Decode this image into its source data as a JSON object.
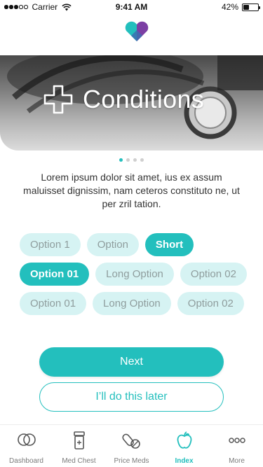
{
  "status_bar": {
    "carrier": "Carrier",
    "time": "9:41 AM",
    "battery_percent": "42%",
    "battery_level": 0.42
  },
  "colors": {
    "accent": "#23bfbd",
    "chip_bg": "#d6f3f3",
    "logo_left": "#23bfbd",
    "logo_right": "#7c3fa4"
  },
  "hero": {
    "title": "Conditions",
    "icon": "plus-cross-icon"
  },
  "pager": {
    "count": 4,
    "active_index": 0
  },
  "description": "Lorem ipsum dolor sit amet, ius ex assum maluisset dignissim, nam ceteros constituto ne, ut per zril tation.",
  "options": {
    "rows": [
      [
        {
          "label": "Option 1",
          "selected": false
        },
        {
          "label": "Option",
          "selected": false
        },
        {
          "label": "Short",
          "selected": true
        }
      ],
      [
        {
          "label": "Option 01",
          "selected": true
        },
        {
          "label": "Long Option",
          "selected": false
        },
        {
          "label": "Option 02",
          "selected": false
        }
      ],
      [
        {
          "label": "Option 01",
          "selected": false
        },
        {
          "label": "Long Option",
          "selected": false
        },
        {
          "label": "Option 02",
          "selected": false
        }
      ]
    ]
  },
  "buttons": {
    "next": "Next",
    "later": "I’ll do this later"
  },
  "tab_bar": {
    "items": [
      {
        "label": "Dashboard",
        "icon": "rings-icon",
        "active": false
      },
      {
        "label": "Med Chest",
        "icon": "pill-bottle-icon",
        "active": false
      },
      {
        "label": "Price Meds",
        "icon": "pills-icon",
        "active": false
      },
      {
        "label": "Index",
        "icon": "apple-icon",
        "active": true
      },
      {
        "label": "More",
        "icon": "more-dots-icon",
        "active": false
      }
    ]
  }
}
